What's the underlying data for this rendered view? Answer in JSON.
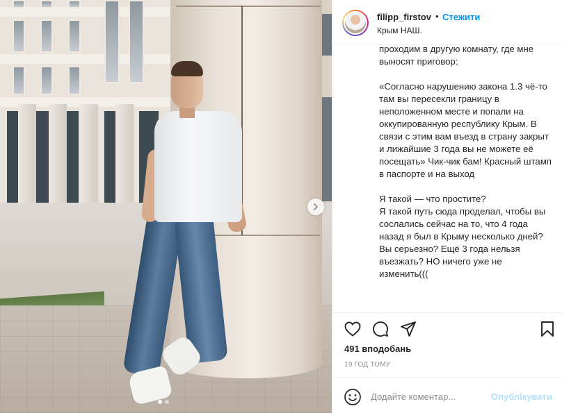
{
  "post": {
    "dots": 2,
    "active_dot": 0
  },
  "header": {
    "username": "filipp_firstov",
    "separator": "•",
    "follow_label": "Стежити",
    "location": "Крым НАШ."
  },
  "caption": {
    "text": "проходим в другую комнату, где мне выносят приговор:\n\n«Согласно нарушению закона 1.3 чё-то там вы пересекли границу в неположенном месте и попали на оккупированную республику Крым. В связи с этим вам въезд в страну закрыт и лижайшие 3 года вы не можете её посещать» Чик-чик бам! Красный штамп в паспорте и на выход\n\nЯ такой — что простите?\nЯ такой путь сюда проделал, чтобы вы сослались сейчас на то, что 4 года назад я был в Крыму несколько дней? Вы серьезно? Ещё 3 года нельзя въезжать? НО ничего уже не изменить((("
  },
  "actions": {
    "like_icon": "heart-icon",
    "comment_icon": "comment-icon",
    "share_icon": "paper-plane-icon",
    "save_icon": "bookmark-icon"
  },
  "stats": {
    "likes": "491 вподобань",
    "timestamp": "19 ГОД ТОМУ"
  },
  "comment": {
    "placeholder": "Додайте коментар...",
    "publish_label": "Опублікувати"
  },
  "colors": {
    "accent": "#0095f6",
    "publish_disabled": "#b2dffc",
    "text": "#262626",
    "muted": "#8e8e8e",
    "border": "#efefef"
  }
}
